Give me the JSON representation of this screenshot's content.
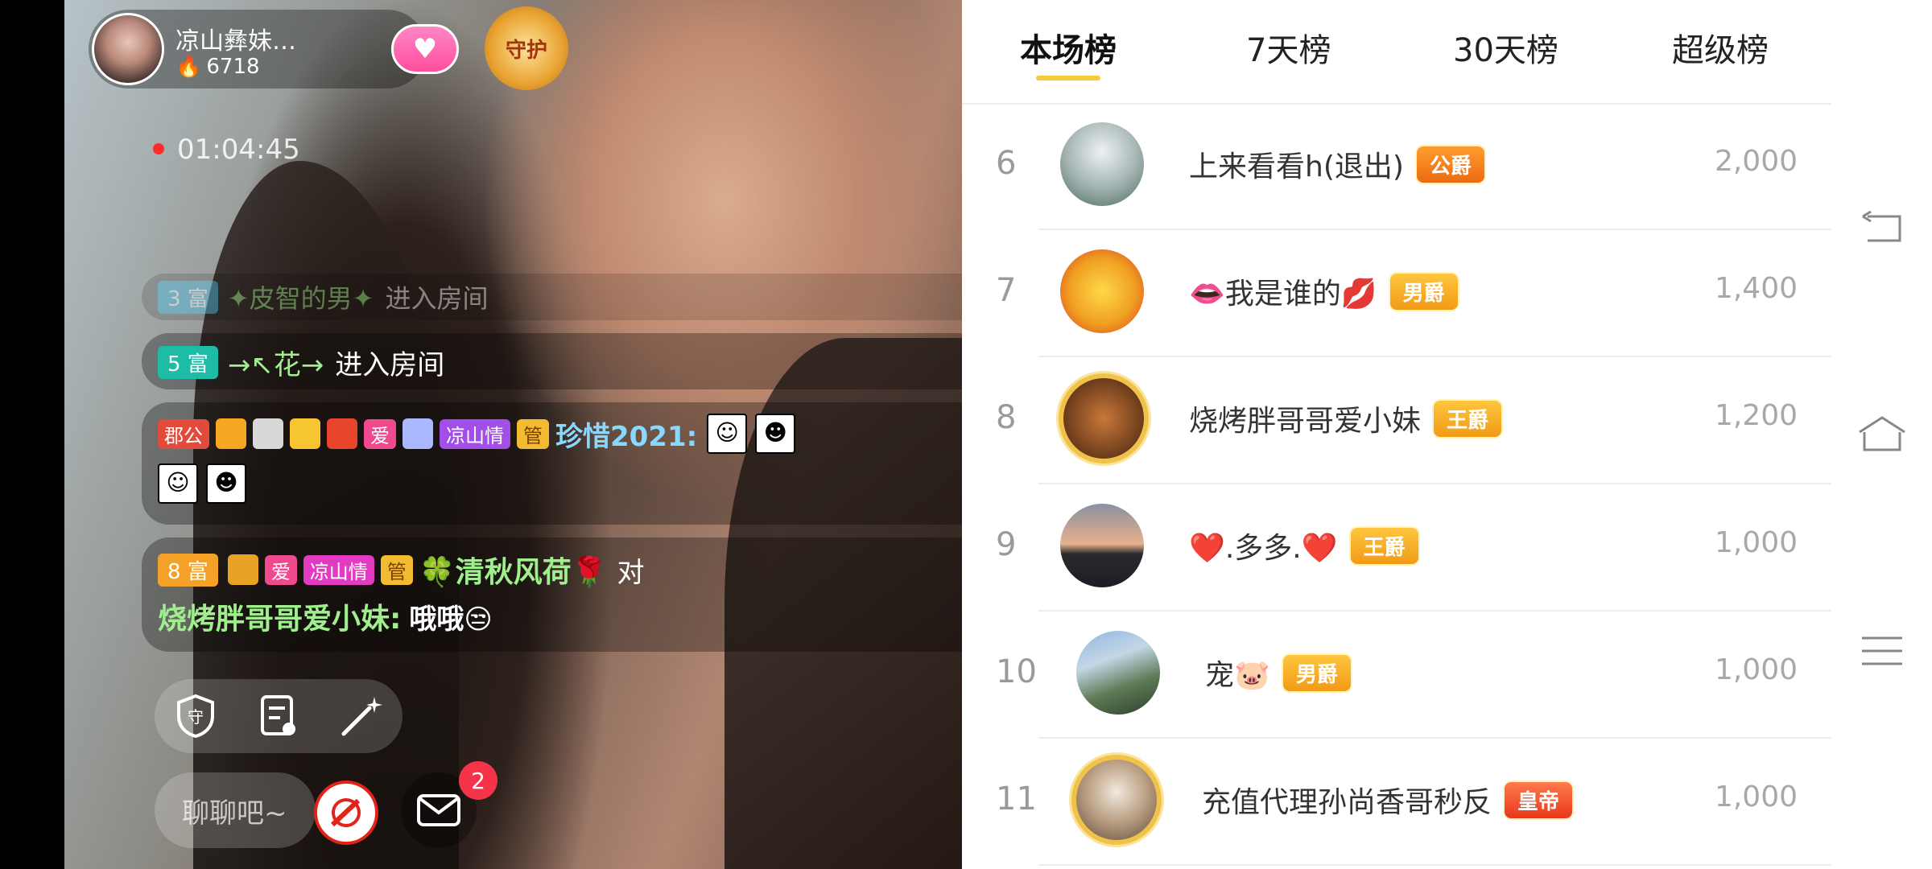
{
  "stream": {
    "anchor": {
      "name": "凉山彝妹…",
      "hot_value": "6718"
    },
    "follow_icon": "heart-icon",
    "guard_badge_label": "守护",
    "live_timer": "01:04:45",
    "chat": [
      {
        "level": "3 富",
        "user": "✦皮智的男✦",
        "action": "进入房间"
      },
      {
        "level": "5 富",
        "user": "→↖花→",
        "action": "进入房间"
      },
      {
        "tags": [
          "郡公",
          "爱",
          "凉山情",
          "管"
        ],
        "user": "珍惜2021:",
        "message": ""
      },
      {
        "level": "8 富",
        "tags": [
          "爱",
          "凉山情",
          "管"
        ],
        "user": "🍀清秋风荷🌹",
        "connector": "对",
        "target": "烧烤胖哥哥爱小妹:",
        "message": "哦哦😒"
      }
    ],
    "tools": [
      "shield-icon",
      "note-icon",
      "magic-wand-icon"
    ],
    "chat_input_placeholder": "聊聊吧~",
    "message_badge": "2"
  },
  "ranking": {
    "tabs": [
      "本场榜",
      "7天榜",
      "30天榜",
      "超级榜"
    ],
    "active_tab": 0,
    "rows": [
      {
        "rank": "6",
        "name": "上来看看h(退出)",
        "badge": "公爵",
        "score": "2,000"
      },
      {
        "rank": "7",
        "name": "👄我是谁的💋",
        "badge": "男爵",
        "score": "1,400"
      },
      {
        "rank": "8",
        "name": "烧烤胖哥哥爱小妹",
        "badge": "王爵",
        "score": "1,200"
      },
      {
        "rank": "9",
        "name": "❤️.多多.❤️",
        "badge": "王爵",
        "score": "1,000"
      },
      {
        "rank": "10",
        "name": "宠🐷",
        "badge": "男爵",
        "score": "1,000"
      },
      {
        "rank": "11",
        "name": "充值代理孙尚香哥秒反",
        "badge": "皇帝",
        "score": "1,000"
      }
    ]
  },
  "nav": [
    "back-icon",
    "home-icon",
    "menu-icon"
  ]
}
